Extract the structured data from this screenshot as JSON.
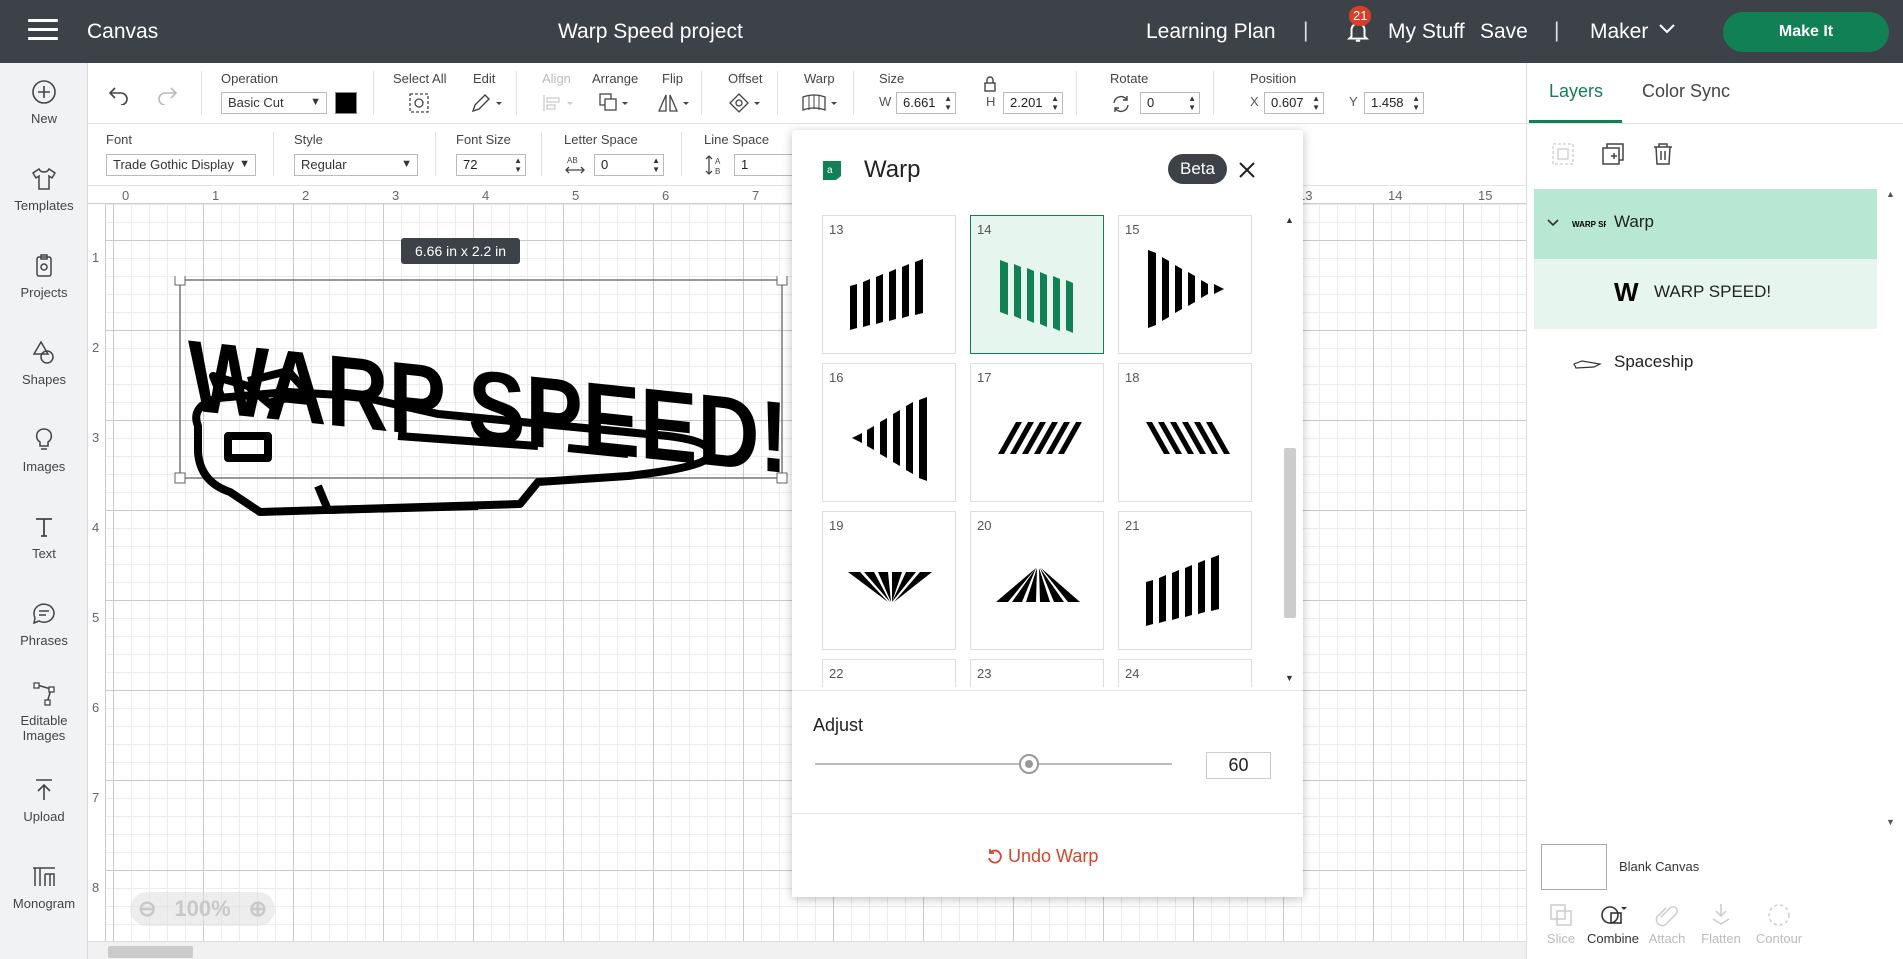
{
  "topbar": {
    "app_title": "Canvas",
    "project_title": "Warp Speed project",
    "learning_plan": "Learning Plan",
    "separator": "|",
    "notification_count": "21",
    "my_stuff": "My Stuff",
    "save": "Save",
    "machine": "Maker",
    "make_it": "Make It"
  },
  "sidebar": {
    "items": [
      {
        "label": "New",
        "icon": "plus-circle-icon"
      },
      {
        "label": "Templates",
        "icon": "shirt-icon"
      },
      {
        "label": "Projects",
        "icon": "projects-icon"
      },
      {
        "label": "Shapes",
        "icon": "shapes-icon"
      },
      {
        "label": "Images",
        "icon": "lightbulb-icon"
      },
      {
        "label": "Text",
        "icon": "text-icon"
      },
      {
        "label": "Phrases",
        "icon": "speech-bubble-icon"
      },
      {
        "label": "Editable Images",
        "icon": "editable-images-icon"
      },
      {
        "label": "Upload",
        "icon": "upload-icon"
      },
      {
        "label": "Monogram",
        "icon": "monogram-icon"
      }
    ]
  },
  "toolbar": {
    "operation_label": "Operation",
    "operation_value": "Basic Cut",
    "select_all": "Select All",
    "edit": "Edit",
    "align": "Align",
    "arrange": "Arrange",
    "flip": "Flip",
    "offset": "Offset",
    "warp": "Warp",
    "size": "Size",
    "w_label": "W",
    "w_value": "6.661",
    "h_label": "H",
    "h_value": "2.201",
    "rotate": "Rotate",
    "rotate_value": "0",
    "position": "Position",
    "x_label": "X",
    "x_value": "0.607",
    "y_label": "Y",
    "y_value": "1.458",
    "operation_color": "#000000"
  },
  "textbar": {
    "font_label": "Font",
    "font_value": "Trade Gothic Display",
    "style_label": "Style",
    "style_value": "Regular",
    "font_size_label": "Font Size",
    "font_size_value": "72",
    "letter_space_label": "Letter Space",
    "letter_space_value": "0",
    "line_space_label": "Line Space",
    "line_space_value": "1"
  },
  "canvas": {
    "ruler_top": [
      "0",
      "1",
      "2",
      "3",
      "4",
      "5",
      "6",
      "7",
      "13",
      "14",
      "15"
    ],
    "ruler_left": [
      "1",
      "2",
      "3",
      "4",
      "5",
      "6",
      "7",
      "8"
    ],
    "size_tooltip": "6.66  in x 2.2  in",
    "design_text": "WARP SPEED!",
    "zoom": "100%"
  },
  "warp_panel": {
    "title": "Warp",
    "badge": "Beta",
    "tiles": [
      {
        "num": "13",
        "selected": false
      },
      {
        "num": "14",
        "selected": true
      },
      {
        "num": "15",
        "selected": false
      },
      {
        "num": "16",
        "selected": false
      },
      {
        "num": "17",
        "selected": false
      },
      {
        "num": "18",
        "selected": false
      },
      {
        "num": "19",
        "selected": false
      },
      {
        "num": "20",
        "selected": false
      },
      {
        "num": "21",
        "selected": false
      },
      {
        "num": "22",
        "selected": false
      },
      {
        "num": "23",
        "selected": false
      },
      {
        "num": "24",
        "selected": false
      }
    ],
    "adjust_label": "Adjust",
    "adjust_value": "60",
    "adjust_fraction": 0.6,
    "undo": "Undo Warp"
  },
  "right_panel": {
    "tabs": [
      {
        "label": "Layers",
        "active": true
      },
      {
        "label": "Color Sync",
        "active": false
      }
    ],
    "layers": [
      {
        "label": "Warp",
        "kind": "group"
      },
      {
        "label": "WARP SPEED!",
        "kind": "text"
      },
      {
        "label": "Spaceship",
        "kind": "image"
      }
    ],
    "blank_canvas": "Blank Canvas",
    "tools": [
      {
        "label": "Slice",
        "active": false
      },
      {
        "label": "Combine",
        "active": true
      },
      {
        "label": "Attach",
        "active": false
      },
      {
        "label": "Flatten",
        "active": false
      },
      {
        "label": "Contour",
        "active": false
      }
    ]
  },
  "colors": {
    "accent": "#128055",
    "topbar": "#3d4248",
    "undo": "#d5452b",
    "badge": "#d5402b"
  }
}
